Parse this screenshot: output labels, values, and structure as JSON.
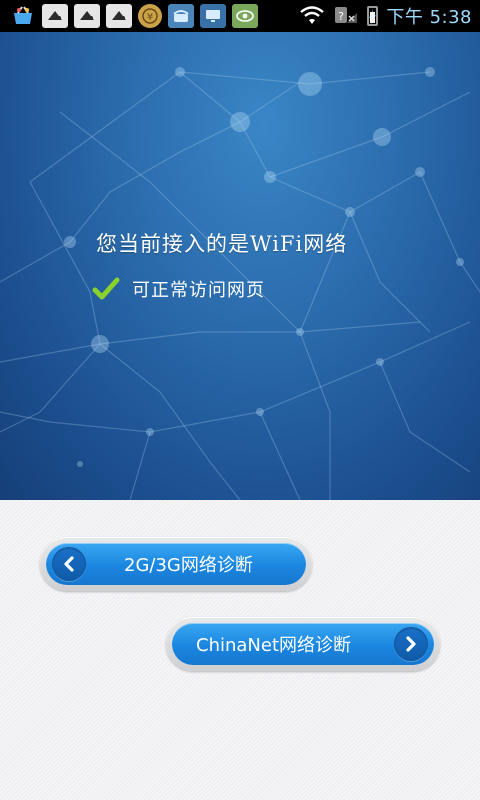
{
  "status_bar": {
    "time": "下午 5:38",
    "left_icons": [
      "basket-icon",
      "gamepad-icon",
      "gamepad-icon",
      "gamepad-icon",
      "coin-icon",
      "phone-icon",
      "monitor-icon",
      "eye-icon"
    ],
    "right_icons": [
      "wifi-icon",
      "no-signal-icon",
      "battery-charging-icon"
    ]
  },
  "hero": {
    "title": "您当前接入的是WiFi网络",
    "status_text": "可正常访问网页",
    "check_color": "#8ad12b"
  },
  "buttons": {
    "diag_2g3g": {
      "label": "2G/3G网络诊断",
      "icon": "chevron-left-icon"
    },
    "diag_chinanet": {
      "label": "ChinaNet网络诊断",
      "icon": "chevron-right-icon"
    }
  },
  "colors": {
    "hero_blue": "#2a6aab",
    "button_blue": "#1b86e0",
    "background": "#efeff1",
    "status_bar": "#000000"
  }
}
